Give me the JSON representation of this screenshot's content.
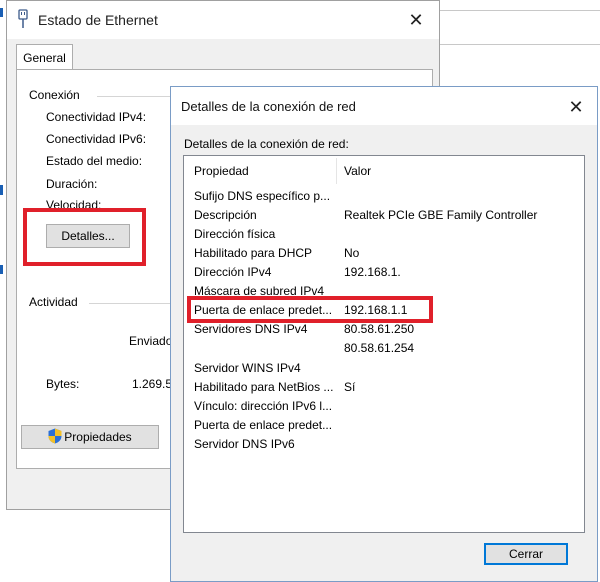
{
  "ethernet_window": {
    "title": "Estado de Ethernet",
    "tab_general": "General",
    "section_connection": "Conexión",
    "labels": {
      "ipv4": "Conectividad IPv4:",
      "ipv6": "Conectividad IPv6:",
      "media_state": "Estado del medio:",
      "duration": "Duración:",
      "speed": "Velocidad:"
    },
    "details_button": "Detalles...",
    "section_activity": "Actividad",
    "sent_label": "Enviado",
    "bytes_label": "Bytes:",
    "bytes_value": "1.269.5",
    "properties_button": "Propiedades"
  },
  "details_dialog": {
    "title": "Detalles de la conexión de red",
    "list_label": "Detalles de la conexión de red:",
    "col_property": "Propiedad",
    "col_value": "Valor",
    "rows": [
      {
        "prop": "Sufijo DNS específico p...",
        "val": ""
      },
      {
        "prop": "Descripción",
        "val": "Realtek PCIe GBE Family Controller"
      },
      {
        "prop": "Dirección física",
        "val": ""
      },
      {
        "prop": "Habilitado para DHCP",
        "val": "No"
      },
      {
        "prop": "Dirección IPv4",
        "val": "192.168.1."
      },
      {
        "prop": "Máscara de subred IPv4",
        "val": ""
      },
      {
        "prop": "Puerta de enlace predet...",
        "val": "192.168.1.1"
      },
      {
        "prop": "Servidores DNS IPv4",
        "val": "80.58.61.250"
      },
      {
        "prop": "",
        "val": "80.58.61.254"
      },
      {
        "prop": "Servidor WINS IPv4",
        "val": ""
      },
      {
        "prop": "Habilitado para NetBios ...",
        "val": "Sí"
      },
      {
        "prop": "Vínculo: dirección IPv6 l...",
        "val": ""
      },
      {
        "prop": "Puerta de enlace predet...",
        "val": ""
      },
      {
        "prop": "Servidor DNS IPv6",
        "val": ""
      }
    ],
    "close_button": "Cerrar"
  },
  "colors": {
    "highlight_red": "#e0202a",
    "accent_blue": "#0078d7"
  }
}
